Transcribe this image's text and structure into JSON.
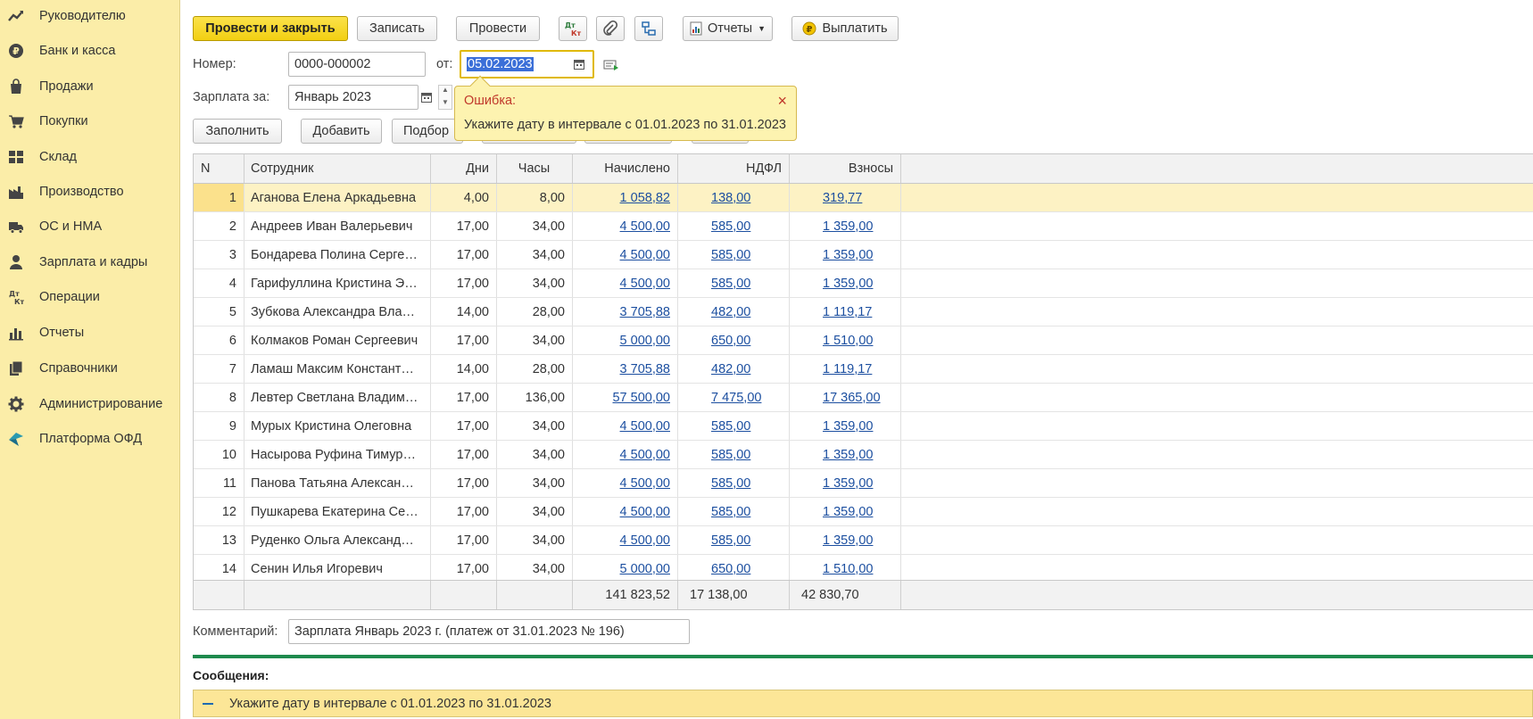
{
  "sidebar": {
    "items": [
      {
        "label": "Руководителю",
        "icon": "trend-icon"
      },
      {
        "label": "Банк и касса",
        "icon": "ruble-coin-icon"
      },
      {
        "label": "Продажи",
        "icon": "shopping-bag-icon"
      },
      {
        "label": "Покупки",
        "icon": "cart-icon"
      },
      {
        "label": "Склад",
        "icon": "warehouse-grid-icon"
      },
      {
        "label": "Производство",
        "icon": "factory-icon"
      },
      {
        "label": "ОС и НМА",
        "icon": "truck-icon"
      },
      {
        "label": "Зарплата и кадры",
        "icon": "person-icon"
      },
      {
        "label": "Операции",
        "icon": "debit-credit-icon"
      },
      {
        "label": "Отчеты",
        "icon": "bar-chart-icon"
      },
      {
        "label": "Справочники",
        "icon": "books-icon"
      },
      {
        "label": "Администрирование",
        "icon": "gear-icon"
      },
      {
        "label": "Платформа ОФД",
        "icon": "ofd-logo-icon"
      }
    ]
  },
  "toolbar": {
    "post_close": "Провести и закрыть",
    "save": "Записать",
    "post": "Провести",
    "reports": "Отчеты",
    "pay": "Выплатить",
    "dtkt_top": "Дт",
    "dtkt_bottom": "Кт"
  },
  "form": {
    "number_label": "Номер:",
    "number_value": "0000-000002",
    "date_label": "от:",
    "date_value": "05.02.2023",
    "period_label": "Зарплата за:",
    "period_value": "Январь 2023"
  },
  "tooltip": {
    "title": "Ошибка:",
    "message": "Укажите дату в интервале с 01.01.2023 по 31.01.2023",
    "close": "×"
  },
  "table_toolbar": {
    "fill": "Заполнить",
    "add": "Добавить",
    "select": "Подбор"
  },
  "table": {
    "headers": {
      "n": "N",
      "employee": "Сотрудник",
      "days": "Дни",
      "hours": "Часы",
      "accrued": "Начислено",
      "ndfl": "НДФЛ",
      "contrib": "Взносы"
    },
    "rows": [
      {
        "n": "1",
        "employee": "Аганова Елена Аркадьевна",
        "days": "4,00",
        "hours": "8,00",
        "accrued": "1 058,82",
        "ndfl": "138,00",
        "contrib": "319,77"
      },
      {
        "n": "2",
        "employee": "Андреев Иван Валерьевич",
        "days": "17,00",
        "hours": "34,00",
        "accrued": "4 500,00",
        "ndfl": "585,00",
        "contrib": "1 359,00"
      },
      {
        "n": "3",
        "employee": "Бондарева Полина Серге…",
        "days": "17,00",
        "hours": "34,00",
        "accrued": "4 500,00",
        "ndfl": "585,00",
        "contrib": "1 359,00"
      },
      {
        "n": "4",
        "employee": "Гарифуллина Кристина Э…",
        "days": "17,00",
        "hours": "34,00",
        "accrued": "4 500,00",
        "ndfl": "585,00",
        "contrib": "1 359,00"
      },
      {
        "n": "5",
        "employee": "Зубкова Александра Вла…",
        "days": "14,00",
        "hours": "28,00",
        "accrued": "3 705,88",
        "ndfl": "482,00",
        "contrib": "1 119,17"
      },
      {
        "n": "6",
        "employee": "Колмаков Роман Сергеевич",
        "days": "17,00",
        "hours": "34,00",
        "accrued": "5 000,00",
        "ndfl": "650,00",
        "contrib": "1 510,00"
      },
      {
        "n": "7",
        "employee": "Ламаш Максим Констант…",
        "days": "14,00",
        "hours": "28,00",
        "accrued": "3 705,88",
        "ndfl": "482,00",
        "contrib": "1 119,17"
      },
      {
        "n": "8",
        "employee": "Левтер Светлана Владим…",
        "days": "17,00",
        "hours": "136,00",
        "accrued": "57 500,00",
        "ndfl": "7 475,00",
        "contrib": "17 365,00"
      },
      {
        "n": "9",
        "employee": "Мурых Кристина Олеговна",
        "days": "17,00",
        "hours": "34,00",
        "accrued": "4 500,00",
        "ndfl": "585,00",
        "contrib": "1 359,00"
      },
      {
        "n": "10",
        "employee": "Насырова Руфина Тимур…",
        "days": "17,00",
        "hours": "34,00",
        "accrued": "4 500,00",
        "ndfl": "585,00",
        "contrib": "1 359,00"
      },
      {
        "n": "11",
        "employee": "Панова Татьяна Алексан…",
        "days": "17,00",
        "hours": "34,00",
        "accrued": "4 500,00",
        "ndfl": "585,00",
        "contrib": "1 359,00"
      },
      {
        "n": "12",
        "employee": "Пушкарева Екатерина Се…",
        "days": "17,00",
        "hours": "34,00",
        "accrued": "4 500,00",
        "ndfl": "585,00",
        "contrib": "1 359,00"
      },
      {
        "n": "13",
        "employee": "Руденко Ольга Александ…",
        "days": "17,00",
        "hours": "34,00",
        "accrued": "4 500,00",
        "ndfl": "585,00",
        "contrib": "1 359,00"
      },
      {
        "n": "14",
        "employee": "Сенин Илья Игоревич",
        "days": "17,00",
        "hours": "34,00",
        "accrued": "5 000,00",
        "ndfl": "650,00",
        "contrib": "1 510,00"
      }
    ],
    "totals": {
      "accrued": "141 823,52",
      "ndfl": "17 138,00",
      "contrib": "42 830,70"
    }
  },
  "comment": {
    "label": "Комментарий:",
    "value": "Зарплата Январь 2023 г. (платеж от 31.01.2023 № 196)"
  },
  "messages": {
    "title": "Сообщения:",
    "items": [
      "Укажите дату в интервале с 01.01.2023 по 31.01.2023"
    ]
  },
  "colors": {
    "sidebar_bg": "#fbeda8",
    "primary_button": "#f2cf12",
    "link": "#1c4fa0",
    "error": "#c0382b",
    "separator": "#1e8a4d"
  }
}
